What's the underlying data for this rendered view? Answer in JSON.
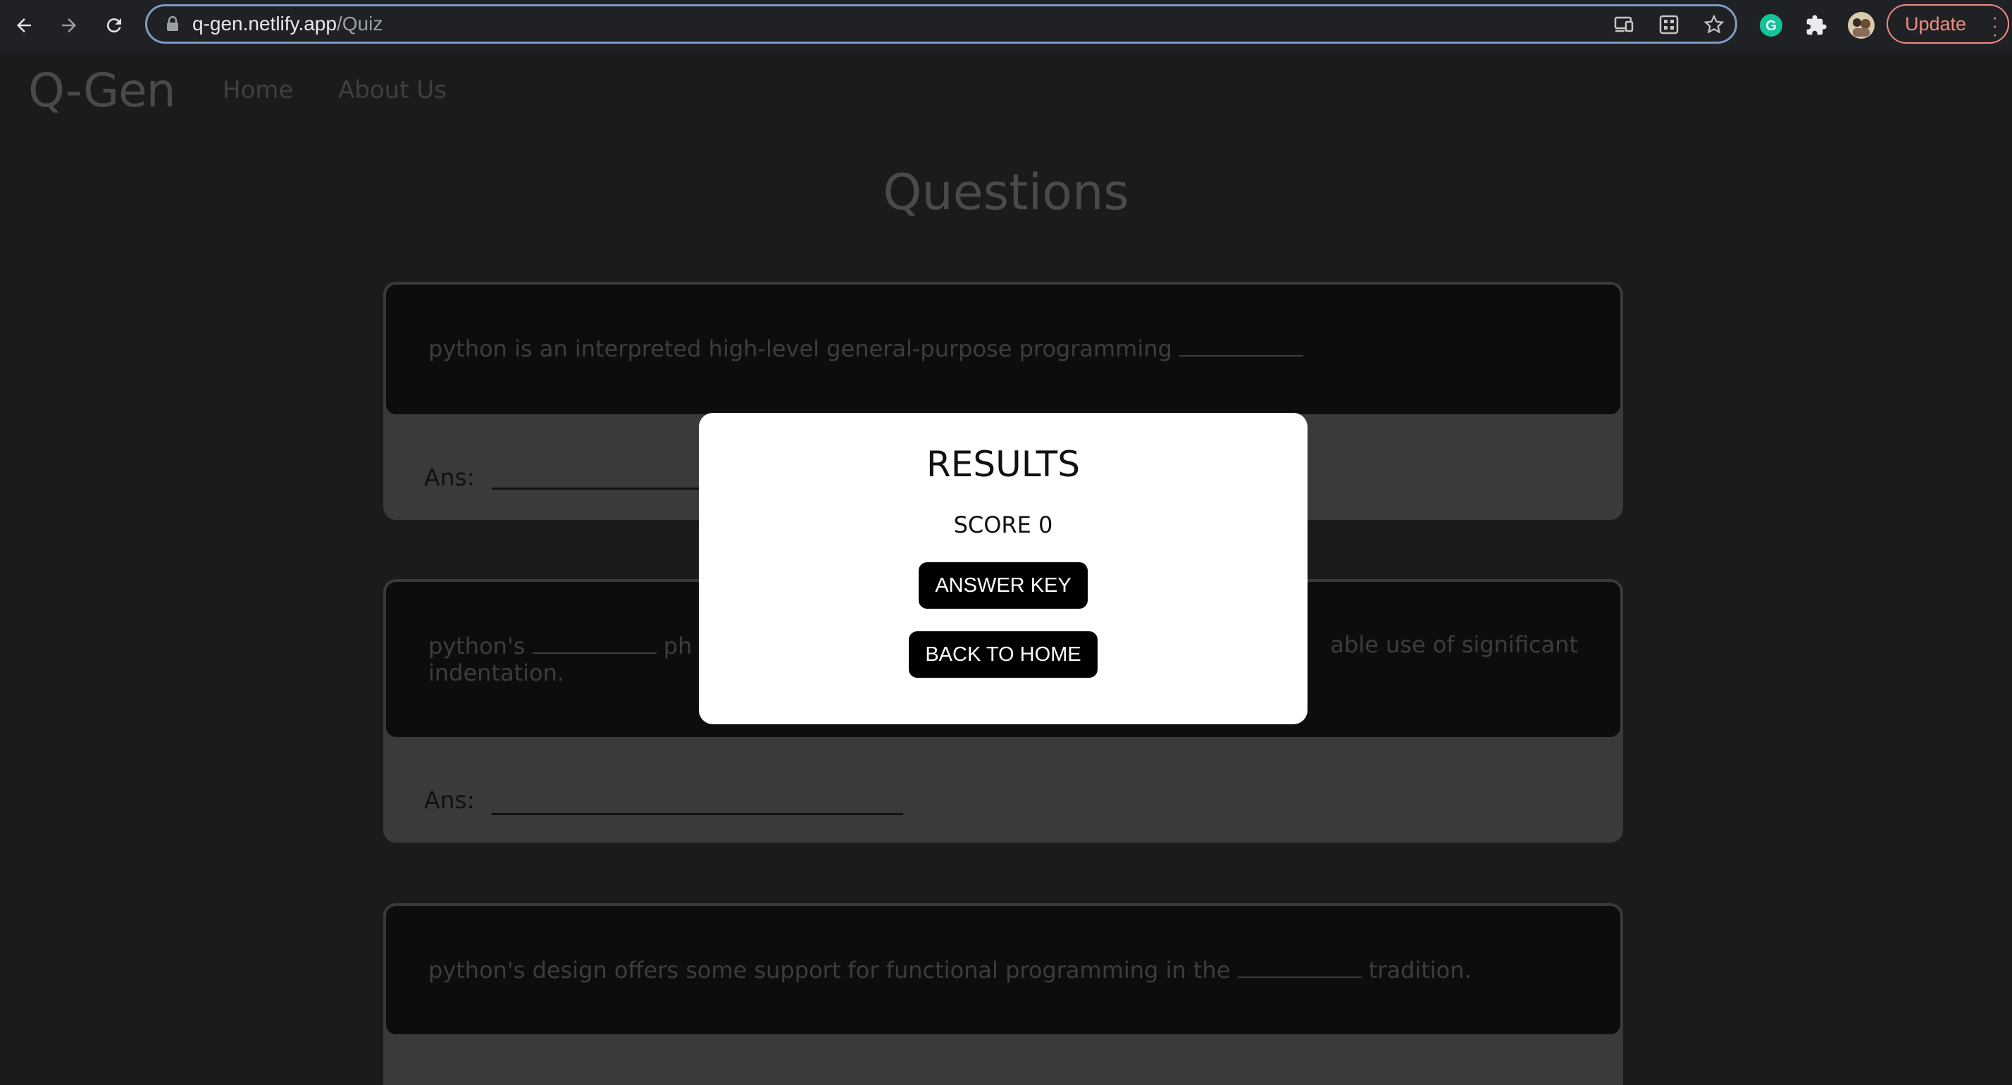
{
  "browser": {
    "url_host": "q-gen.netlify.app",
    "url_path": "/Quiz",
    "update_label": "Update",
    "icons": [
      "back-arrow-icon",
      "forward-arrow-icon",
      "reload-icon",
      "lock-icon",
      "cast-icon",
      "qr-code-icon",
      "star-icon",
      "grammarly-icon",
      "extensions-puzzle-icon",
      "profile-avatar",
      "menu-dots-icon"
    ]
  },
  "site": {
    "logo": "Q-Gen",
    "nav": [
      "Home",
      "About Us"
    ],
    "page_title": "Questions"
  },
  "questions": [
    {
      "before": "python is an interpreted high-level general-purpose programming",
      "after": "",
      "ans_label": "Ans:"
    },
    {
      "before": "python's",
      "middle_visible": "ph",
      "tail_visible": "able use of significant",
      "line2": "indentation.",
      "ans_label": "Ans:"
    },
    {
      "before": "python's design offers some support for functional programming in the",
      "after": "tradition."
    }
  ],
  "modal": {
    "title": "RESULTS",
    "score_label": "SCORE 0",
    "answer_key_label": "ANSWER KEY",
    "back_home_label": "BACK TO HOME"
  },
  "colors": {
    "accent_update": "#f28b82",
    "grammarly": "#15c39a",
    "modal_bg": "#ffffff",
    "button_bg": "#000000"
  }
}
